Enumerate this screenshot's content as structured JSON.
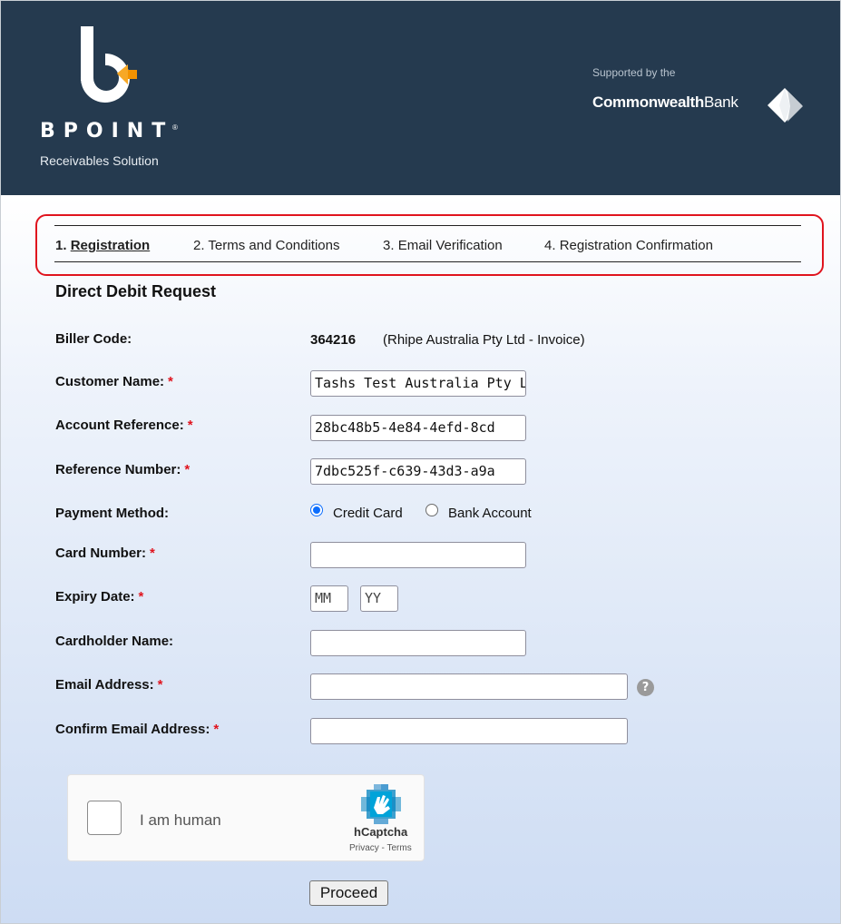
{
  "header": {
    "brand": "BPOINT",
    "brand_tm": "®",
    "brand_subtitle": "Receivables Solution",
    "supported_by": "Supported by the",
    "bank_name_bold": "Commonwealth",
    "bank_name_regular": "Bank"
  },
  "steps": [
    {
      "number": "1.",
      "label": "Registration",
      "active": true
    },
    {
      "number": "2.",
      "label": "Terms and Conditions",
      "active": false
    },
    {
      "number": "3.",
      "label": "Email Verification",
      "active": false
    },
    {
      "number": "4.",
      "label": "Registration Confirmation",
      "active": false
    }
  ],
  "form": {
    "title": "Direct Debit Request",
    "biller_code": {
      "label": "Biller Code:",
      "value": "364216",
      "description": "(Rhipe Australia Pty Ltd - Invoice)"
    },
    "customer_name": {
      "label": "Customer Name:",
      "value": "Tashs Test Australia Pty Ltd"
    },
    "account_reference": {
      "label": "Account Reference:",
      "value": "28bc48b5-4e84-4efd-8cd"
    },
    "reference_number": {
      "label": "Reference Number:",
      "value": "7dbc525f-c639-43d3-a9a"
    },
    "payment_method": {
      "label": "Payment Method:",
      "options": [
        {
          "label": "Credit Card",
          "selected": true
        },
        {
          "label": "Bank Account",
          "selected": false
        }
      ]
    },
    "card_number": {
      "label": "Card Number:",
      "value": ""
    },
    "expiry_date": {
      "label": "Expiry Date:",
      "month_placeholder": "MM",
      "year_placeholder": "YY"
    },
    "cardholder_name": {
      "label": "Cardholder Name:",
      "value": ""
    },
    "email_address": {
      "label": "Email Address:",
      "value": ""
    },
    "confirm_email": {
      "label": "Confirm Email Address:",
      "value": ""
    },
    "required_marker": "*"
  },
  "captcha": {
    "label": "I am human",
    "brand": "hCaptcha",
    "links": "Privacy - Terms"
  },
  "proceed_label": "Proceed",
  "colors": {
    "header_bg": "#253a4f",
    "accent_orange": "#f39200",
    "required_red": "#e0141e",
    "radio_blue": "#0d6efd"
  }
}
